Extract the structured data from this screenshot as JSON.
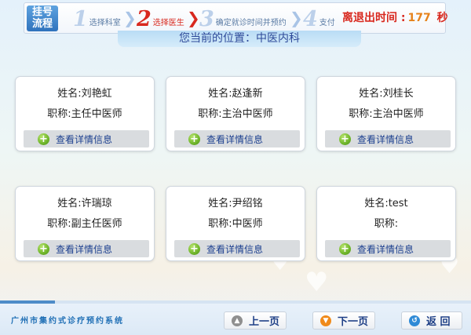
{
  "flow_badge": {
    "line1": "挂号",
    "line2": "流程"
  },
  "steps": [
    {
      "num": "1",
      "label": "选择科室"
    },
    {
      "num": "2",
      "label": "选择医生"
    },
    {
      "num": "3",
      "label": "确定就诊时间并预约"
    },
    {
      "num": "4",
      "label": "支付"
    }
  ],
  "active_step": 2,
  "timer": {
    "label": "离退出时间 :",
    "value": "177",
    "unit": "秒"
  },
  "location": "您当前的位置：中医内科",
  "doctors": [
    {
      "name": "姓名:刘艳虹",
      "title": "职称:主任中医师",
      "detail": "查看详情信息"
    },
    {
      "name": "姓名:赵逢新",
      "title": "职称:主治中医师",
      "detail": "查看详情信息"
    },
    {
      "name": "姓名:刘桂长",
      "title": "职称:主治中医师",
      "detail": "查看详情信息"
    },
    {
      "name": "姓名:许瑞琼",
      "title": "职称:副主任医师",
      "detail": "查看详情信息"
    },
    {
      "name": "姓名:尹绍铭",
      "title": "职称:中医师",
      "detail": "查看详情信息"
    },
    {
      "name": "姓名:test",
      "title": "职称:",
      "detail": "查看详情信息"
    }
  ],
  "footer": {
    "system_name": "广州市集约式诊疗预约系统",
    "prev_label": "上一页",
    "next_label": "下一页",
    "back_label": "返 回"
  },
  "colors": {
    "accent_red": "#d8281e",
    "brand_blue": "#2f73bd",
    "plus_green": "#6fb52a"
  }
}
